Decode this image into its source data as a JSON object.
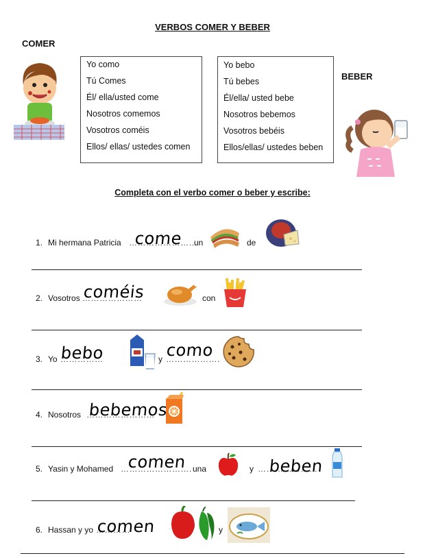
{
  "title": "VERBOS COMER Y BEBER",
  "comer_label": "COMER",
  "beber_label": "BEBER",
  "comer_table": [
    "Yo como",
    "Tú Comes",
    "Él/ ella/usted come",
    "Nosotros comemos",
    "Vosotros coméis",
    "Ellos/ ellas/ ustedes comen"
  ],
  "beber_table": [
    "Yo bebo",
    "Tú bebes",
    "Él/ella/ usted bebe",
    "Nosotros bebemos",
    "Vosotros bebéis",
    "Ellos/ellas/ ustedes beben"
  ],
  "instruction": "Completa con el verbo comer o beber y escribe:",
  "exercises": {
    "e1": {
      "num": "1.",
      "subject": "Mi hermana Patricia",
      "dots": "……………………",
      "answer": "come",
      "word1": "un",
      "word2": "de"
    },
    "e2": {
      "num": "2.",
      "subject": "Vosotros",
      "answer": "coméis",
      "dots": "…………………",
      "word1": "con"
    },
    "e3": {
      "num": "3.",
      "subject": "Yo",
      "answer1": "bebo",
      "dots1": "……………",
      "word1": "y",
      "answer2": "como",
      "dots2": "………………."
    },
    "e4": {
      "num": "4.",
      "subject": "Nosotros",
      "answer": "bebemos",
      "dots": "……………………"
    },
    "e5": {
      "num": "5.",
      "subject": "Yasin y Mohamed",
      "answer1": "comen",
      "dots1": "…………………….",
      "word1": "una",
      "word2": "y",
      "answer2": "beben",
      "dots2": "…………………"
    },
    "e6": {
      "num": "6.",
      "subject": "Hassan y yo",
      "answer": "comen",
      "dots": "…………",
      "word1": "y"
    }
  },
  "icons": [
    "boy-eating-icon",
    "girl-drinking-icon",
    "sandwich-icon",
    "cheese-plate-icon",
    "roast-chicken-icon",
    "french-fries-icon",
    "milk-icon",
    "cookie-icon",
    "juice-box-icon",
    "apple-icon",
    "water-bottle-icon",
    "peppers-icon",
    "fish-plate-icon"
  ]
}
